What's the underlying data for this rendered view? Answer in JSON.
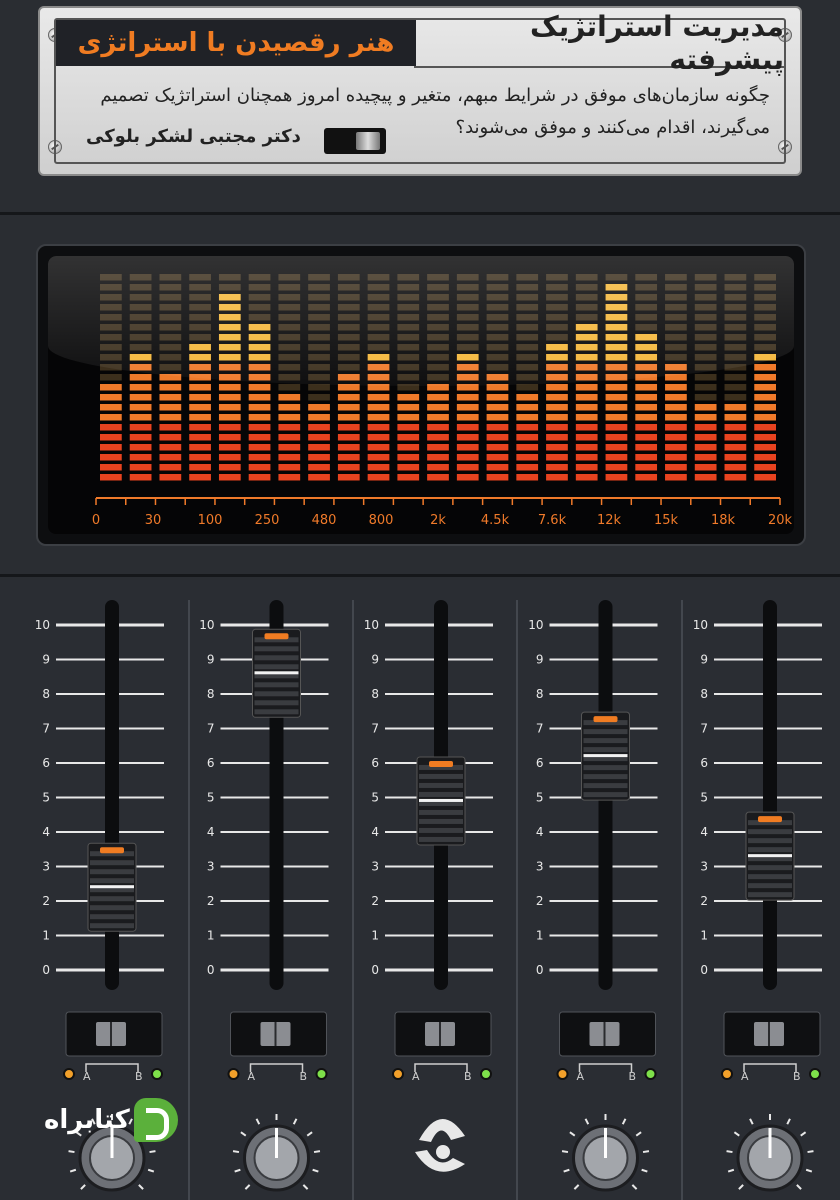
{
  "cover": {
    "title": "مدیریت استراتژیک پیشرفته",
    "subtitle": "هنر رقصیدن با استراتژی",
    "description": "چگونه سازمان‌های موفق در شرایط مبهم، متغیر و پیچیده امروز همچنان استراتژیک تصمیم می‌گیرند، اقدام می‌کنند و موفق می‌شوند؟",
    "author": "دکتر مجتبی لشکر بلوکی"
  },
  "equalizer": {
    "freq_labels": [
      "0",
      "30",
      "100",
      "250",
      "480",
      "800",
      "2k",
      "4.5k",
      "7.6k",
      "12k",
      "15k",
      "18k",
      "20k"
    ],
    "band_levels": [
      10,
      13,
      11,
      14,
      19,
      16,
      9,
      8,
      11,
      13,
      9,
      10,
      13,
      11,
      9,
      14,
      16,
      20,
      15,
      12,
      8,
      8,
      13
    ],
    "total_cells": 21,
    "colors": {
      "low": "#e8431f",
      "mid": "#f07a2a",
      "high": "#f5b73a",
      "dim": "#4a3a22"
    }
  },
  "mixer": {
    "scale": [
      "10",
      "9",
      "8",
      "7",
      "6",
      "5",
      "4",
      "3",
      "2",
      "1",
      "0"
    ],
    "channels": [
      {
        "level": 2.4,
        "switch_a": "A",
        "switch_b": "B"
      },
      {
        "level": 8.6,
        "switch_a": "A",
        "switch_b": "B"
      },
      {
        "level": 4.9,
        "switch_a": "A",
        "switch_b": "B"
      },
      {
        "level": 6.2,
        "switch_a": "A",
        "switch_b": "B"
      },
      {
        "level": 3.3,
        "switch_a": "A",
        "switch_b": "B"
      }
    ],
    "led_left_color": "#f2a02a",
    "led_right_color": "#7ee04a",
    "accent": "#f07c22"
  },
  "brand": {
    "name": "کتابراه",
    "brand_color": "#5bb03b"
  }
}
